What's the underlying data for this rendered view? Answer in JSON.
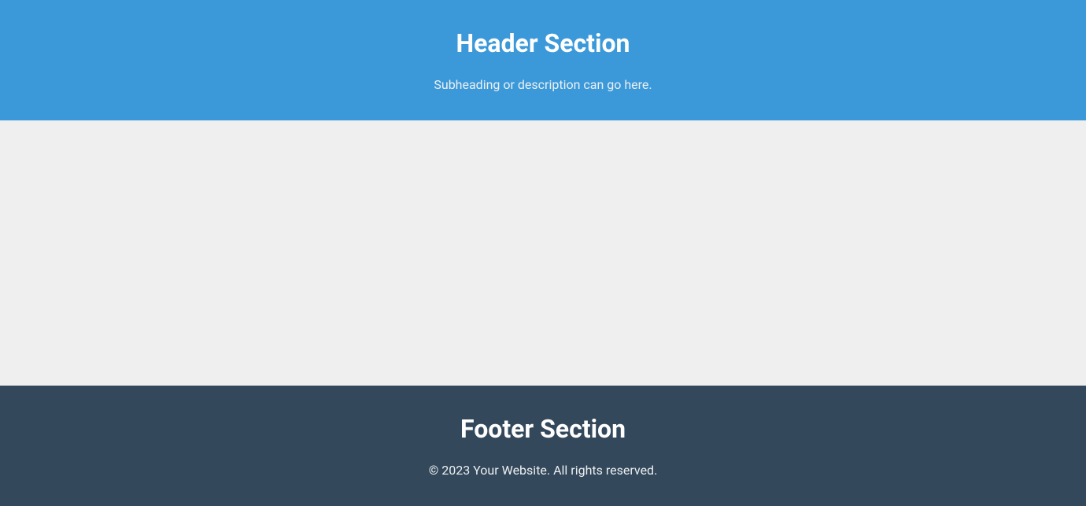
{
  "header": {
    "title": "Header Section",
    "subtitle": "Subheading or description can go here."
  },
  "footer": {
    "title": "Footer Section",
    "copyright": "© 2023 Your Website. All rights reserved."
  }
}
